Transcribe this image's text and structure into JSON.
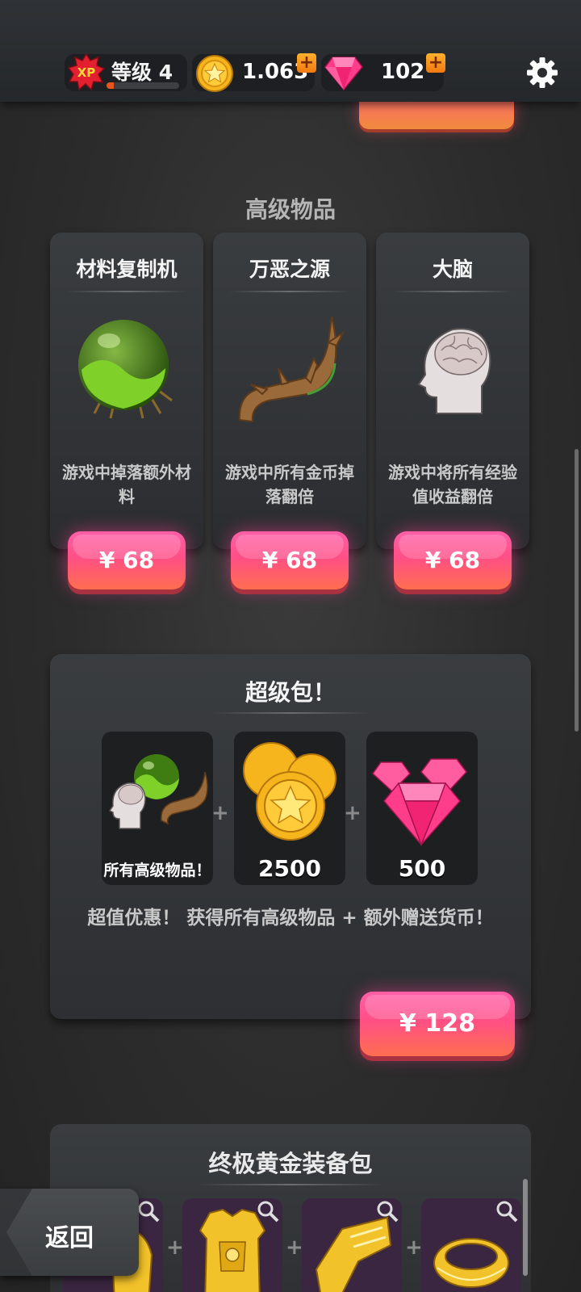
{
  "header": {
    "xp_badge": "XP",
    "level_label": "等级",
    "level_number": "4",
    "level_progress_percent": 10,
    "coins": "1.063",
    "gems": "102",
    "add_label": "+",
    "icons": {
      "coin": "star-coin-icon",
      "gem": "pink-gem-icon",
      "settings": "gear-icon"
    }
  },
  "premium": {
    "section_title": "高级物品",
    "items": [
      {
        "title": "材料复制机",
        "desc": "游戏中掉落额外材料",
        "price": "¥ 68",
        "icon": "green-orb-icon"
      },
      {
        "title": "万恶之源",
        "desc": "游戏中所有金币掉落翻倍",
        "price": "¥ 68",
        "icon": "thorn-branch-icon"
      },
      {
        "title": "大脑",
        "desc": "游戏中将所有经验值收益翻倍",
        "price": "¥ 68",
        "icon": "brain-head-icon"
      }
    ]
  },
  "super_pack": {
    "title": "超级包！",
    "tiles": [
      {
        "label": "所有高级物品！",
        "icon": "premium-items-icon"
      },
      {
        "count": "2500",
        "icon": "coin-stack-icon"
      },
      {
        "count": "500",
        "icon": "gem-stack-icon"
      }
    ],
    "plus": "+",
    "desc": "超值优惠！ 获得所有高级物品 + 额外赠送货币！",
    "price": "¥ 128"
  },
  "gold_pack": {
    "title": "终极黄金装备包",
    "plus": "+",
    "tiles": [
      {
        "icon": "gold-armor-piece-icon"
      },
      {
        "icon": "gold-chestplate-icon"
      },
      {
        "icon": "gold-gauntlet-icon"
      },
      {
        "icon": "gold-ring-icon"
      }
    ]
  },
  "back_button": {
    "label": "返回"
  },
  "colors": {
    "accent_pink": "#ff4f86",
    "accent_orange": "#ff6e4f",
    "coin_gold": "#f4b41a",
    "gem_pink": "#ff3d8a"
  }
}
